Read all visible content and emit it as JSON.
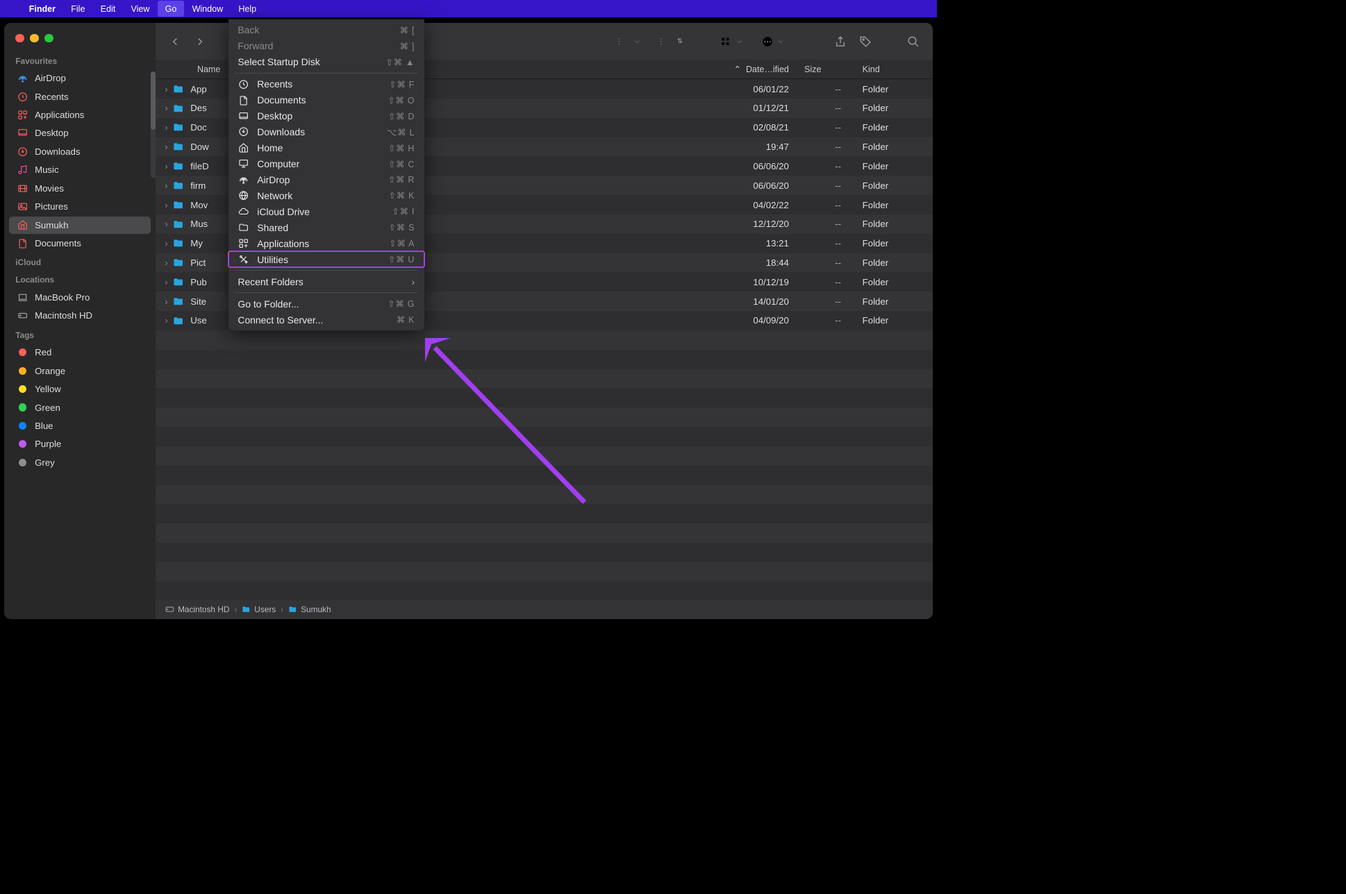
{
  "menubar": {
    "app": "Finder",
    "items": [
      "File",
      "Edit",
      "View",
      "Go",
      "Window",
      "Help"
    ],
    "active": "Go"
  },
  "sidebar": {
    "sections": [
      {
        "title": "Favourites",
        "items": [
          {
            "icon": "airdrop",
            "label": "AirDrop",
            "color": "#3a9cff"
          },
          {
            "icon": "clock",
            "label": "Recents",
            "color": "#ff6060"
          },
          {
            "icon": "grid",
            "label": "Applications",
            "color": "#ff6060"
          },
          {
            "icon": "desktop",
            "label": "Desktop",
            "color": "#ff6060"
          },
          {
            "icon": "download",
            "label": "Downloads",
            "color": "#ff6060"
          },
          {
            "icon": "music",
            "label": "Music",
            "color": "#ff4da6"
          },
          {
            "icon": "movies",
            "label": "Movies",
            "color": "#ff6060"
          },
          {
            "icon": "pictures",
            "label": "Pictures",
            "color": "#ff6060"
          },
          {
            "icon": "home",
            "label": "Sumukh",
            "color": "#ff6060",
            "selected": true
          },
          {
            "icon": "doc",
            "label": "Documents",
            "color": "#ff6060"
          }
        ]
      },
      {
        "title": "iCloud",
        "items": []
      },
      {
        "title": "Locations",
        "items": [
          {
            "icon": "laptop",
            "label": "MacBook Pro",
            "color": "#aaa"
          },
          {
            "icon": "hdd",
            "label": "Macintosh HD",
            "color": "#aaa"
          }
        ]
      },
      {
        "title": "Tags",
        "items": [
          {
            "icon": "tag",
            "label": "Red",
            "color": "#ff6058"
          },
          {
            "icon": "tag",
            "label": "Orange",
            "color": "#ffb020"
          },
          {
            "icon": "tag",
            "label": "Yellow",
            "color": "#ffe020"
          },
          {
            "icon": "tag",
            "label": "Green",
            "color": "#30d158"
          },
          {
            "icon": "tag",
            "label": "Blue",
            "color": "#0a84ff"
          },
          {
            "icon": "tag",
            "label": "Purple",
            "color": "#bf5af2"
          },
          {
            "icon": "tag",
            "label": "Grey",
            "color": "#8e8e93"
          }
        ]
      }
    ]
  },
  "columns": {
    "name": "Name",
    "date": "Date…ified",
    "size": "Size",
    "kind": "Kind"
  },
  "rows": [
    {
      "name": "App",
      "date": "06/01/22",
      "size": "--",
      "kind": "Folder"
    },
    {
      "name": "Des",
      "date": "01/12/21",
      "size": "--",
      "kind": "Folder"
    },
    {
      "name": "Doc",
      "date": "02/08/21",
      "size": "--",
      "kind": "Folder"
    },
    {
      "name": "Dow",
      "date": "19:47",
      "size": "--",
      "kind": "Folder"
    },
    {
      "name": "fileD",
      "date": "06/06/20",
      "size": "--",
      "kind": "Folder"
    },
    {
      "name": "firm",
      "date": "06/06/20",
      "size": "--",
      "kind": "Folder"
    },
    {
      "name": "Mov",
      "date": "04/02/22",
      "size": "--",
      "kind": "Folder"
    },
    {
      "name": "Mus",
      "date": "12/12/20",
      "size": "--",
      "kind": "Folder"
    },
    {
      "name": "My",
      "date": "13:21",
      "size": "--",
      "kind": "Folder"
    },
    {
      "name": "Pict",
      "date": "18:44",
      "size": "--",
      "kind": "Folder"
    },
    {
      "name": "Pub",
      "date": "10/12/19",
      "size": "--",
      "kind": "Folder"
    },
    {
      "name": "Site",
      "date": "14/01/20",
      "size": "--",
      "kind": "Folder"
    },
    {
      "name": "Use",
      "date": "04/09/20",
      "size": "--",
      "kind": "Folder"
    }
  ],
  "dropdown": {
    "top": [
      {
        "label": "Back",
        "shortcut": "⌘ [",
        "dim": true
      },
      {
        "label": "Forward",
        "shortcut": "⌘ ]",
        "dim": true
      },
      {
        "label": "Select Startup Disk",
        "shortcut": "⇧⌘ ▲"
      }
    ],
    "places": [
      {
        "icon": "clock",
        "label": "Recents",
        "shortcut": "⇧⌘ F"
      },
      {
        "icon": "doc",
        "label": "Documents",
        "shortcut": "⇧⌘ O"
      },
      {
        "icon": "desktop",
        "label": "Desktop",
        "shortcut": "⇧⌘ D"
      },
      {
        "icon": "download",
        "label": "Downloads",
        "shortcut": "⌥⌘ L"
      },
      {
        "icon": "home",
        "label": "Home",
        "shortcut": "⇧⌘ H"
      },
      {
        "icon": "computer",
        "label": "Computer",
        "shortcut": "⇧⌘ C"
      },
      {
        "icon": "airdrop",
        "label": "AirDrop",
        "shortcut": "⇧⌘ R"
      },
      {
        "icon": "globe",
        "label": "Network",
        "shortcut": "⇧⌘ K"
      },
      {
        "icon": "cloud",
        "label": "iCloud Drive",
        "shortcut": "⇧⌘ I"
      },
      {
        "icon": "folder",
        "label": "Shared",
        "shortcut": "⇧⌘ S"
      },
      {
        "icon": "grid",
        "label": "Applications",
        "shortcut": "⇧⌘ A"
      },
      {
        "icon": "tools",
        "label": "Utilities",
        "shortcut": "⇧⌘ U",
        "boxed": true
      }
    ],
    "recent": {
      "label": "Recent Folders"
    },
    "bottom": [
      {
        "label": "Go to Folder...",
        "shortcut": "⇧⌘ G"
      },
      {
        "label": "Connect to Server...",
        "shortcut": "⌘ K"
      }
    ]
  },
  "pathbar": [
    "Macintosh HD",
    "Users",
    "Sumukh"
  ]
}
